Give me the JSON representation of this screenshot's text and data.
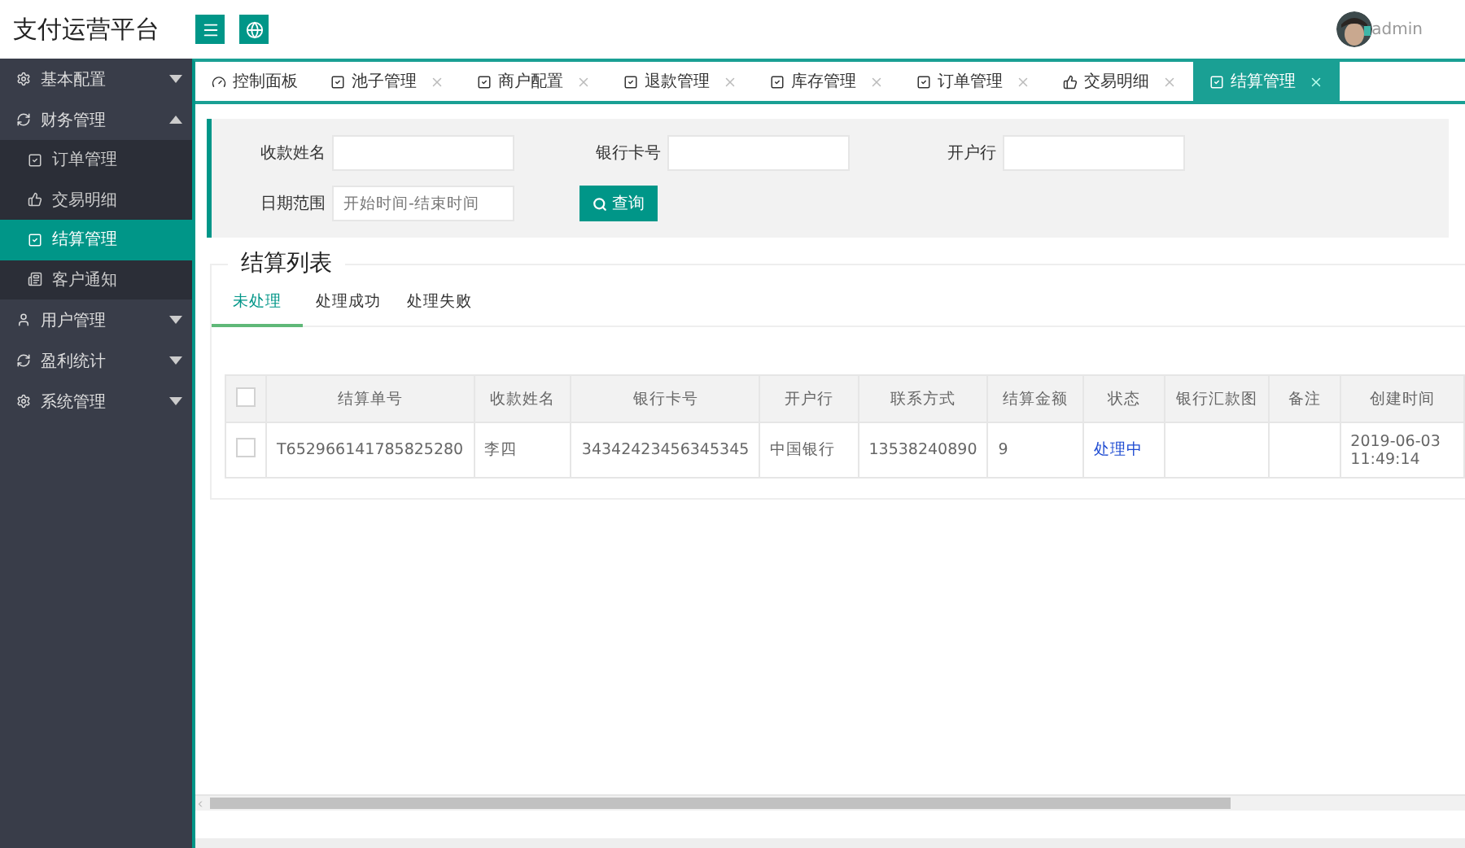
{
  "header": {
    "title": "支付运营平台",
    "user": "admin"
  },
  "sidebar": {
    "items": [
      {
        "label": "基本配置",
        "expanded": false
      },
      {
        "label": "财务管理",
        "expanded": true,
        "children": [
          {
            "label": "订单管理",
            "selected": false
          },
          {
            "label": "交易明细",
            "selected": false
          },
          {
            "label": "结算管理",
            "selected": true
          },
          {
            "label": "客户通知",
            "selected": false
          }
        ]
      },
      {
        "label": "用户管理",
        "expanded": false
      },
      {
        "label": "盈利统计",
        "expanded": false
      },
      {
        "label": "系统管理",
        "expanded": false
      }
    ]
  },
  "tabs": [
    {
      "label": "控制面板",
      "selected": false,
      "closable": false
    },
    {
      "label": "池子管理",
      "selected": false,
      "closable": true
    },
    {
      "label": "商户配置",
      "selected": false,
      "closable": true
    },
    {
      "label": "退款管理",
      "selected": false,
      "closable": true
    },
    {
      "label": "库存管理",
      "selected": false,
      "closable": true
    },
    {
      "label": "订单管理",
      "selected": false,
      "closable": true
    },
    {
      "label": "交易明细",
      "selected": false,
      "closable": true
    },
    {
      "label": "结算管理",
      "selected": true,
      "closable": true
    }
  ],
  "search": {
    "fields": [
      {
        "label": "收款姓名"
      },
      {
        "label": "银行卡号"
      },
      {
        "label": "开户行"
      },
      {
        "label": "日期范围",
        "placeholder": "开始时间-结束时间"
      }
    ],
    "button": "查询"
  },
  "list": {
    "title": "结算列表",
    "tabs": [
      {
        "label": "未处理",
        "selected": true
      },
      {
        "label": "处理成功",
        "selected": false
      },
      {
        "label": "处理失败",
        "selected": false
      }
    ],
    "header_checked": false,
    "columns": [
      "结算单号",
      "收款姓名",
      "银行卡号",
      "开户行",
      "联系方式",
      "结算金额",
      "状态",
      "银行汇款图",
      "备注",
      "创建时间"
    ],
    "rows": [
      {
        "checked": false,
        "cells": [
          {
            "kind": "text",
            "text": "T652966141785825280"
          },
          {
            "kind": "text",
            "text": "李四"
          },
          {
            "kind": "text",
            "text": "34342423456345345"
          },
          {
            "kind": "text",
            "text": "中国银行"
          },
          {
            "kind": "text",
            "text": "13538240890"
          },
          {
            "kind": "text",
            "text": "9"
          },
          {
            "kind": "status",
            "text": "处理中"
          },
          {
            "kind": "blank"
          },
          {
            "kind": "blank"
          },
          {
            "kind": "text",
            "text": "2019-06-03 11:49:14"
          }
        ]
      }
    ]
  }
}
